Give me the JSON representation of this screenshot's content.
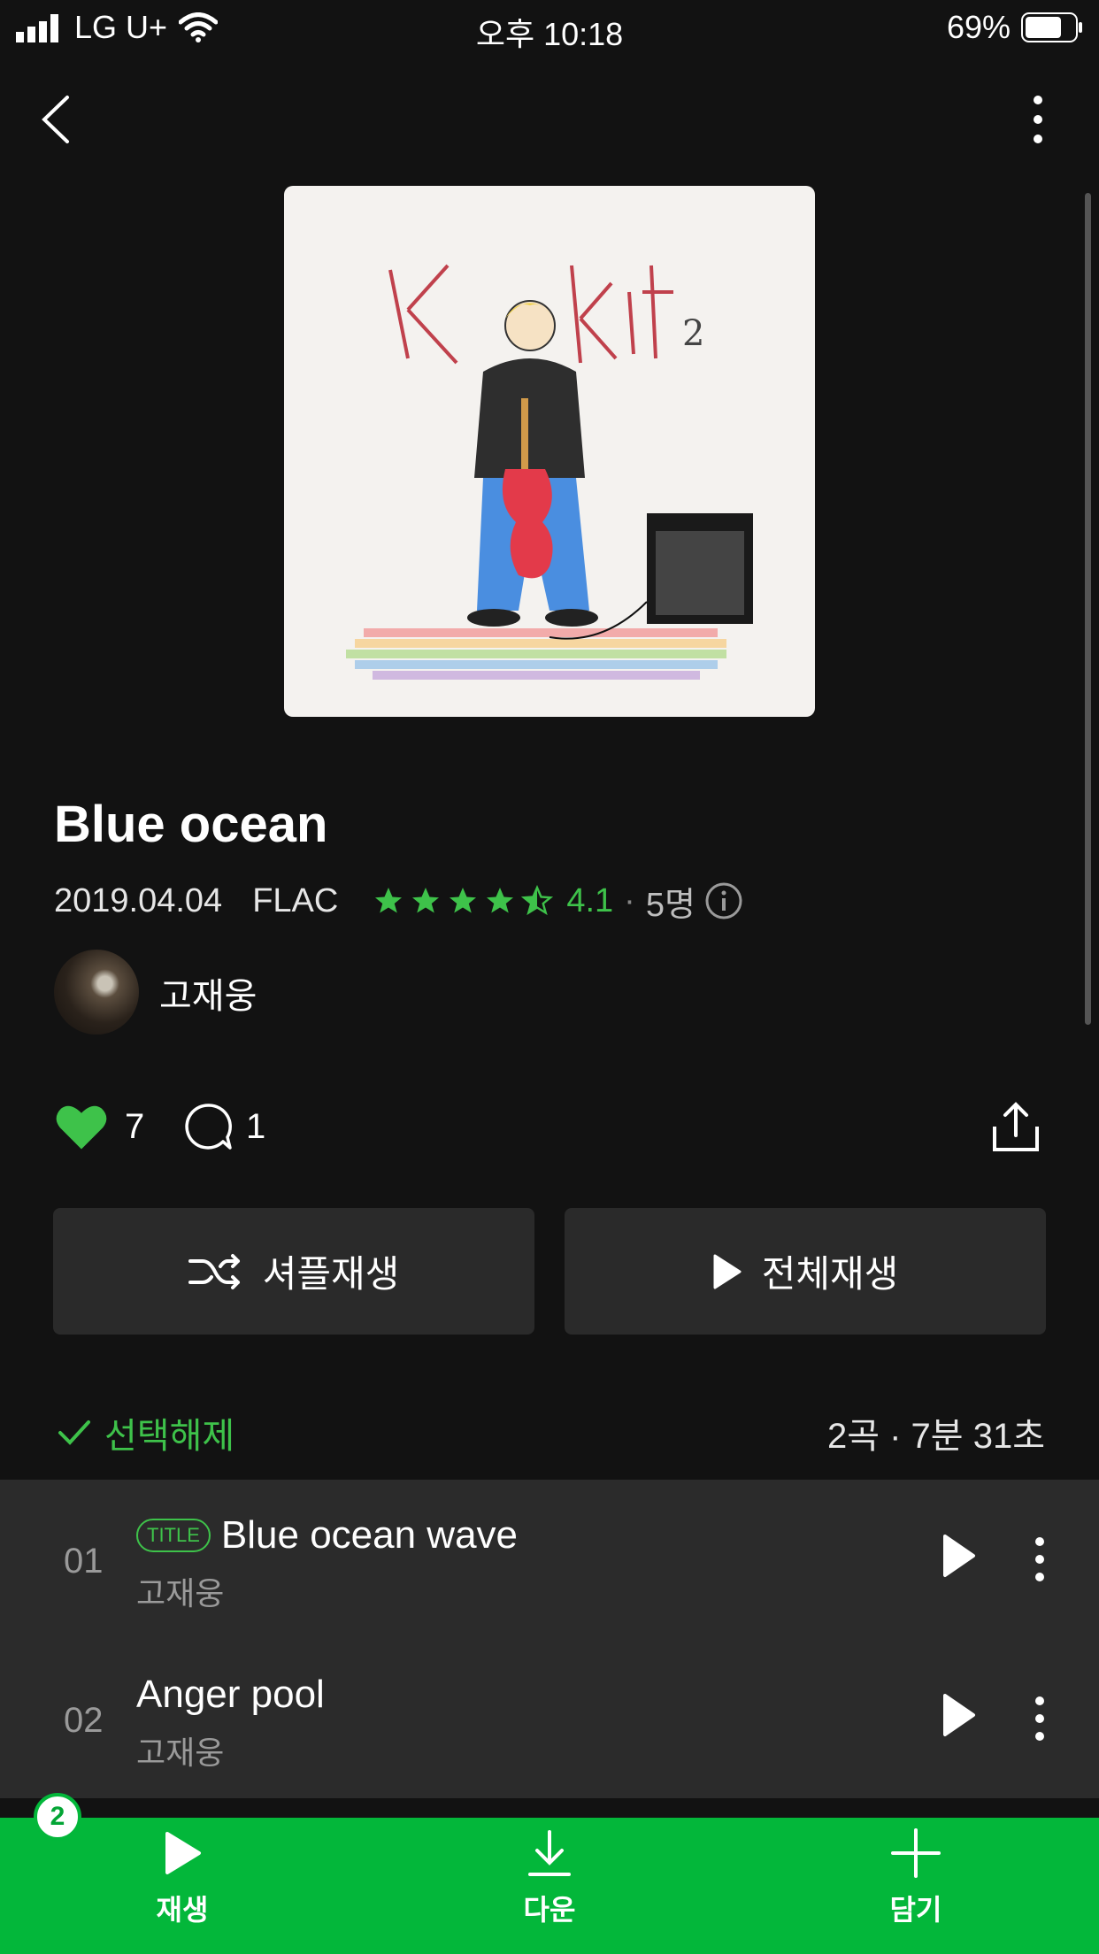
{
  "status_bar": {
    "carrier": "LG U+",
    "time": "오후 10:18",
    "battery": "69%"
  },
  "album": {
    "title": "Blue ocean",
    "date": "2019.04.04",
    "format": "FLAC",
    "rating": "4.1",
    "rating_stars": 4.5,
    "rating_count": "5명",
    "artist": "고재웅",
    "likes": "7",
    "comments": "1"
  },
  "actions": {
    "shuffle": "셔플재생",
    "play_all": "전체재생"
  },
  "selection": {
    "deselect": "선택해제",
    "summary": "2곡 · 7분 31초"
  },
  "tracks": [
    {
      "no": "01",
      "badge": "TITLE",
      "name": "Blue ocean wave",
      "artist": "고재웅"
    },
    {
      "no": "02",
      "name": "Anger pool",
      "artist": "고재웅"
    }
  ],
  "bottom_bar": {
    "badge": "2",
    "play": "재생",
    "download": "다운",
    "add": "담기"
  },
  "colors": {
    "accent": "#3ec24a",
    "bottom_bar": "#03b73a",
    "background": "#121212"
  }
}
